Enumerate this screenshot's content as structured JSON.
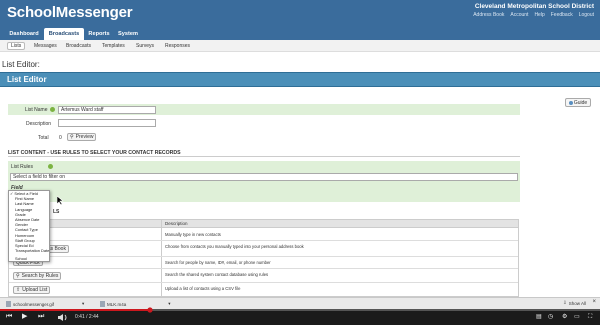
{
  "header": {
    "logo": "SchoolMessenger",
    "district": "Cleveland Metropolitan School District",
    "util_links": [
      "Address Book",
      "Account",
      "Help",
      "Feedback",
      "Logout"
    ]
  },
  "main_nav": [
    "Dashboard",
    "Broadcasts",
    "Reports",
    "System"
  ],
  "main_nav_active": "Broadcasts",
  "sub_nav": [
    "Lists",
    "Messages",
    "Broadcasts",
    "Templates",
    "Surveys",
    "Responses"
  ],
  "sub_nav_active": "Lists",
  "page": {
    "title": "List Editor:",
    "editor_title": "List Editor",
    "guide_label": "Guide"
  },
  "form": {
    "list_name_label": "List Name",
    "list_name_value": "Artemus Ward staff",
    "description_label": "Description",
    "description_value": "",
    "total_label": "Total",
    "total_value": "0",
    "preview_label": "Preview"
  },
  "list_content": {
    "heading": "LIST CONTENT - USE RULES TO SELECT YOUR CONTACT RECORDS",
    "rules_label": "List Rules",
    "rules_input_value": "Select a field to filter on",
    "field_label": "Field",
    "partial_label": "LS"
  },
  "dropdown_options": [
    "Select a Field",
    "First Name",
    "Last Name",
    "Language",
    "Grade",
    "Absence Date",
    "Gender",
    "Contact Type",
    "Homeroom",
    "Staff Group",
    "Special Ed",
    "Transportation Date",
    "School"
  ],
  "dropdown_selected": "Select a Field",
  "table": {
    "column_description": "Description",
    "rows": [
      {
        "button": "",
        "description": "Manually type in new contacts"
      },
      {
        "button": "...ss Book",
        "description": "Choose from contacts you manually typed into your personal address book"
      },
      {
        "button": "Quick Pick",
        "description": "Search for people by name, ID#, email, or phone number"
      },
      {
        "button": "Search by Rules",
        "description": "Search the shared system contact database using rules"
      },
      {
        "button": "Upload List",
        "description": "Upload a list of contacts using a CSV file"
      }
    ]
  },
  "downloads": {
    "items": [
      "schoolmessenger.gif",
      "MLK.m4a"
    ],
    "show_all": "Show All"
  },
  "player": {
    "time": "0:41 / 2:44",
    "progress": 0.25
  },
  "colors": {
    "header_blue": "#3a6c9c",
    "editor_bar": "#4b8fb8",
    "green_row": "#dff0d8",
    "progress_red": "#cc181e"
  }
}
